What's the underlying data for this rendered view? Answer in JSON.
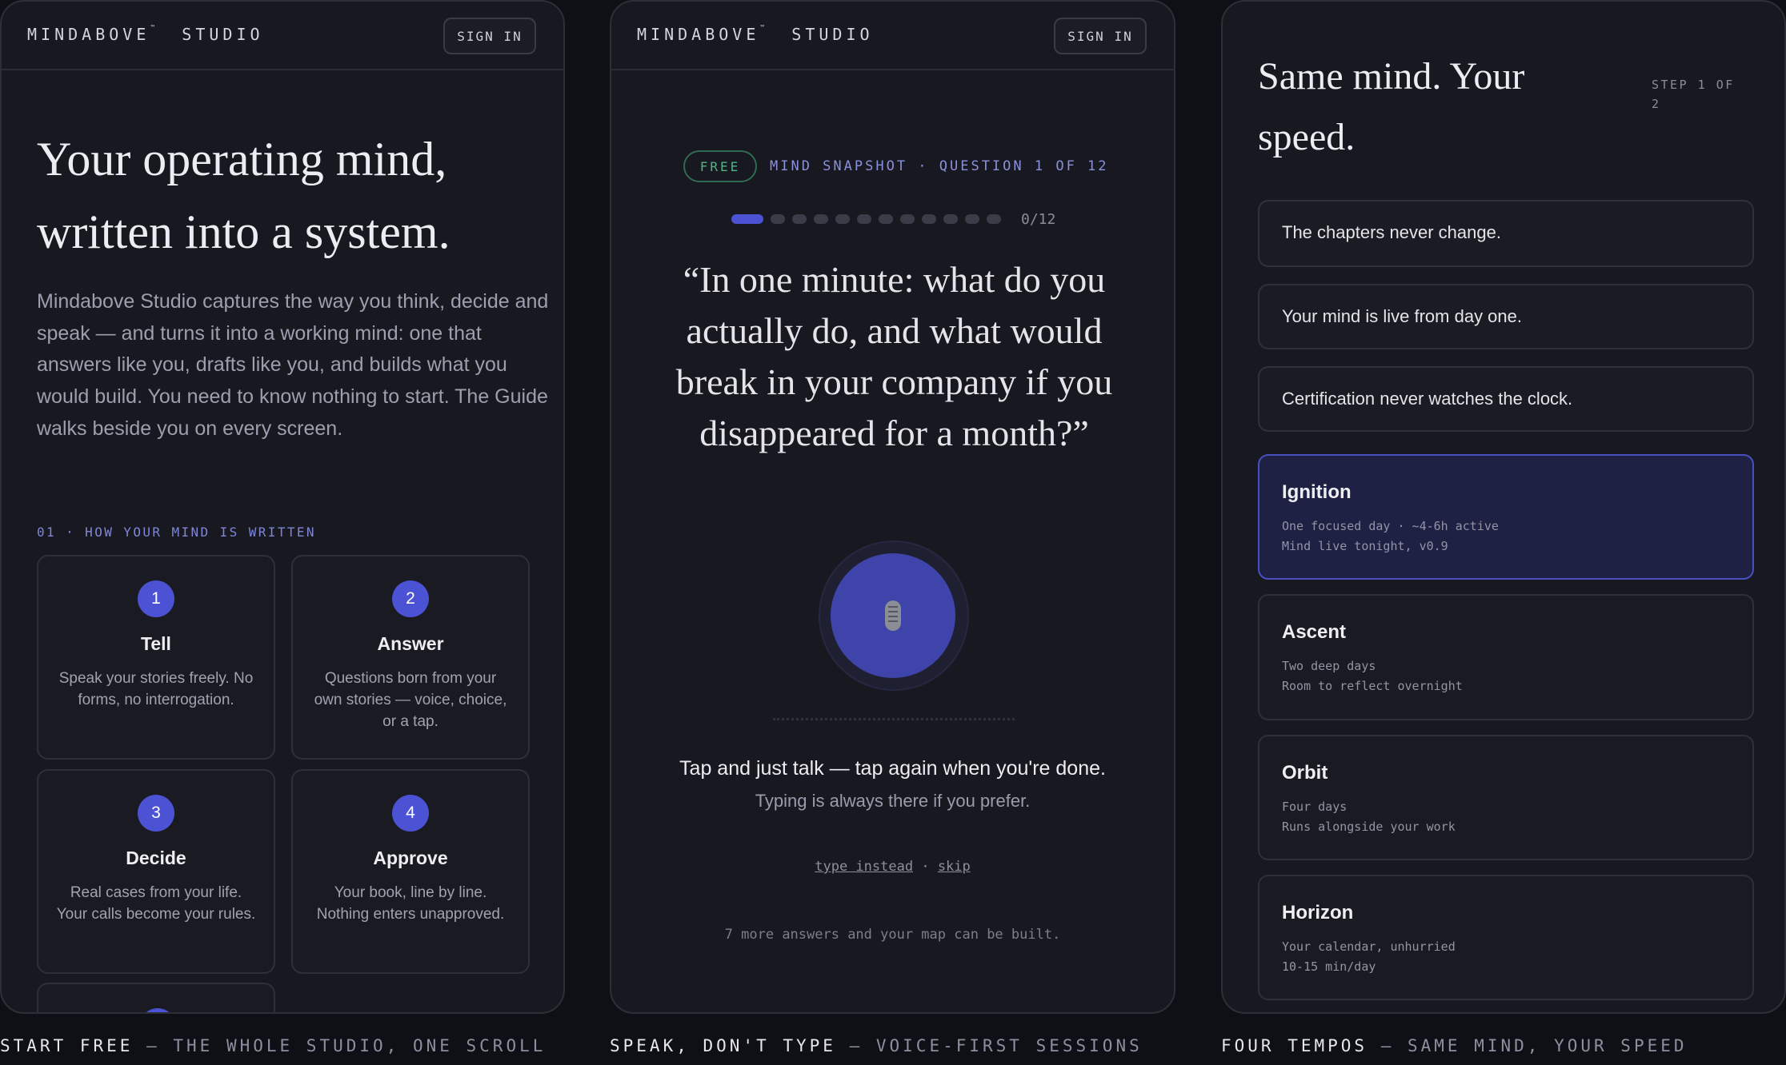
{
  "brand": {
    "name": "MINDABOVE",
    "mark": "™",
    "suffix": "STUDIO"
  },
  "header": {
    "sign_in": "SIGN IN"
  },
  "screen1": {
    "headline": "Your operating mind, written into a system.",
    "lead": "Mindabove Studio captures the way you think, decide and speak — and turns it into a working mind: one that answers like you, drafts like you, and builds what you would build. You need to know nothing to start. The Guide walks beside you on every screen.",
    "section_label": "01 · HOW YOUR MIND IS WRITTEN",
    "steps": [
      {
        "num": "1",
        "title": "Tell",
        "desc": "Speak your stories freely. No forms, no interrogation."
      },
      {
        "num": "2",
        "title": "Answer",
        "desc": "Questions born from your own stories — voice, choice, or a tap."
      },
      {
        "num": "3",
        "title": "Decide",
        "desc": "Real cases from your life. Your calls become your rules."
      },
      {
        "num": "4",
        "title": "Approve",
        "desc": "Your book, line by line. Nothing enters unapproved."
      }
    ]
  },
  "screen2": {
    "badge": "FREE",
    "meta": "MIND SNAPSHOT · QUESTION 1 OF 12",
    "progress": {
      "current": 0,
      "total": 12,
      "label": "0/12"
    },
    "question": "“In one minute: what do you actually do, and what would break in your company if you disappeared for a month?”",
    "mic_icon": "microphone-icon",
    "hint_primary": "Tap and just talk — tap again when you're done.",
    "hint_secondary": "Typing is always there if you prefer.",
    "link_type": "type instead",
    "link_separator": "·",
    "link_skip": "skip",
    "note": "7 more answers and your map can be built."
  },
  "screen3": {
    "headline": "Same mind. Your speed.",
    "step": "STEP 1 OF 2",
    "statements": [
      "The chapters never change.",
      "Your mind is live from day one.",
      "Certification never watches the clock."
    ],
    "selected_tempo": "Ignition",
    "tempos": [
      {
        "title": "Ignition",
        "line1": "One focused day · ~4-6h active",
        "line2": "Mind live tonight, v0.9"
      },
      {
        "title": "Ascent",
        "line1": "Two deep days",
        "line2": "Room to reflect overnight"
      },
      {
        "title": "Orbit",
        "line1": "Four days",
        "line2": "Runs alongside your work"
      },
      {
        "title": "Horizon",
        "line1": "Your calendar, unhurried",
        "line2": "10-15 min/day"
      }
    ]
  },
  "captions": [
    {
      "lead": "START FREE",
      "rest": " — THE WHOLE STUDIO, ONE SCROLL"
    },
    {
      "lead": "SPEAK, DON'T TYPE",
      "rest": " — VOICE-FIRST SESSIONS"
    },
    {
      "lead": "FOUR TEMPOS",
      "rest": " — SAME MIND, YOUR SPEED"
    }
  ],
  "colors": {
    "accent": "#4c52d4",
    "success": "#4fb486",
    "panel": "#181920",
    "background": "#0f1016"
  }
}
